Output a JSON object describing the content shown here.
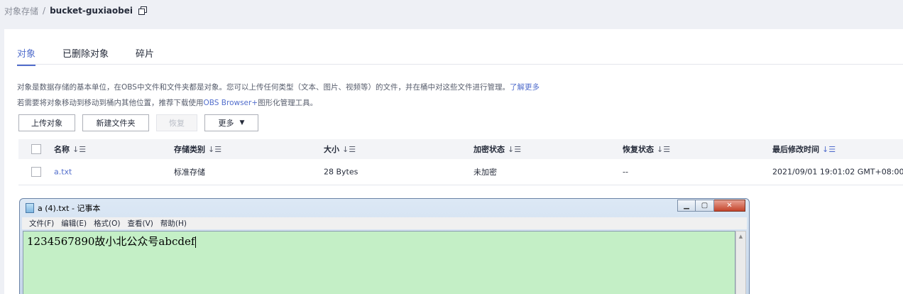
{
  "breadcrumb": {
    "parent": "对象存储",
    "separator": "/",
    "current": "bucket-guxiaobei"
  },
  "tabs": [
    {
      "label": "对象",
      "active": true
    },
    {
      "label": "已删除对象",
      "active": false
    },
    {
      "label": "碎片",
      "active": false
    }
  ],
  "description": {
    "line1": "对象是数据存储的基本单位，在OBS中文件和文件夹都是对象。您可以上传任何类型（文本、图片、视频等）的文件，并在桶中对这些文件进行管理。",
    "line1_link": "了解更多",
    "line2_prefix": "若需要将对象移动到移动到桶内其他位置，推荐下载使用",
    "line2_link": "OBS Browser+",
    "line2_suffix": "图形化管理工具。"
  },
  "toolbar": {
    "upload_label": "上传对象",
    "new_folder_label": "新建文件夹",
    "restore_label": "恢复",
    "more_label": "更多"
  },
  "table": {
    "headers": {
      "name": "名称",
      "storage_class": "存储类别",
      "size": "大小",
      "encryption": "加密状态",
      "restore_status": "恢复状态",
      "last_modified": "最后修改时间"
    },
    "rows": [
      {
        "name": "a.txt",
        "storage_class": "标准存储",
        "size": "28 Bytes",
        "encryption": "未加密",
        "restore_status": "--",
        "last_modified": "2021/09/01 19:01:02 GMT+08:00"
      }
    ]
  },
  "notepad": {
    "title": "a (4).txt - 记事本",
    "menu": [
      "文件(F)",
      "编辑(E)",
      "格式(O)",
      "查看(V)",
      "帮助(H)"
    ],
    "content": "1234567890故小北公众号abcdef"
  },
  "colors": {
    "accent": "#526ecc",
    "notepad_bg": "#c4efc6"
  }
}
